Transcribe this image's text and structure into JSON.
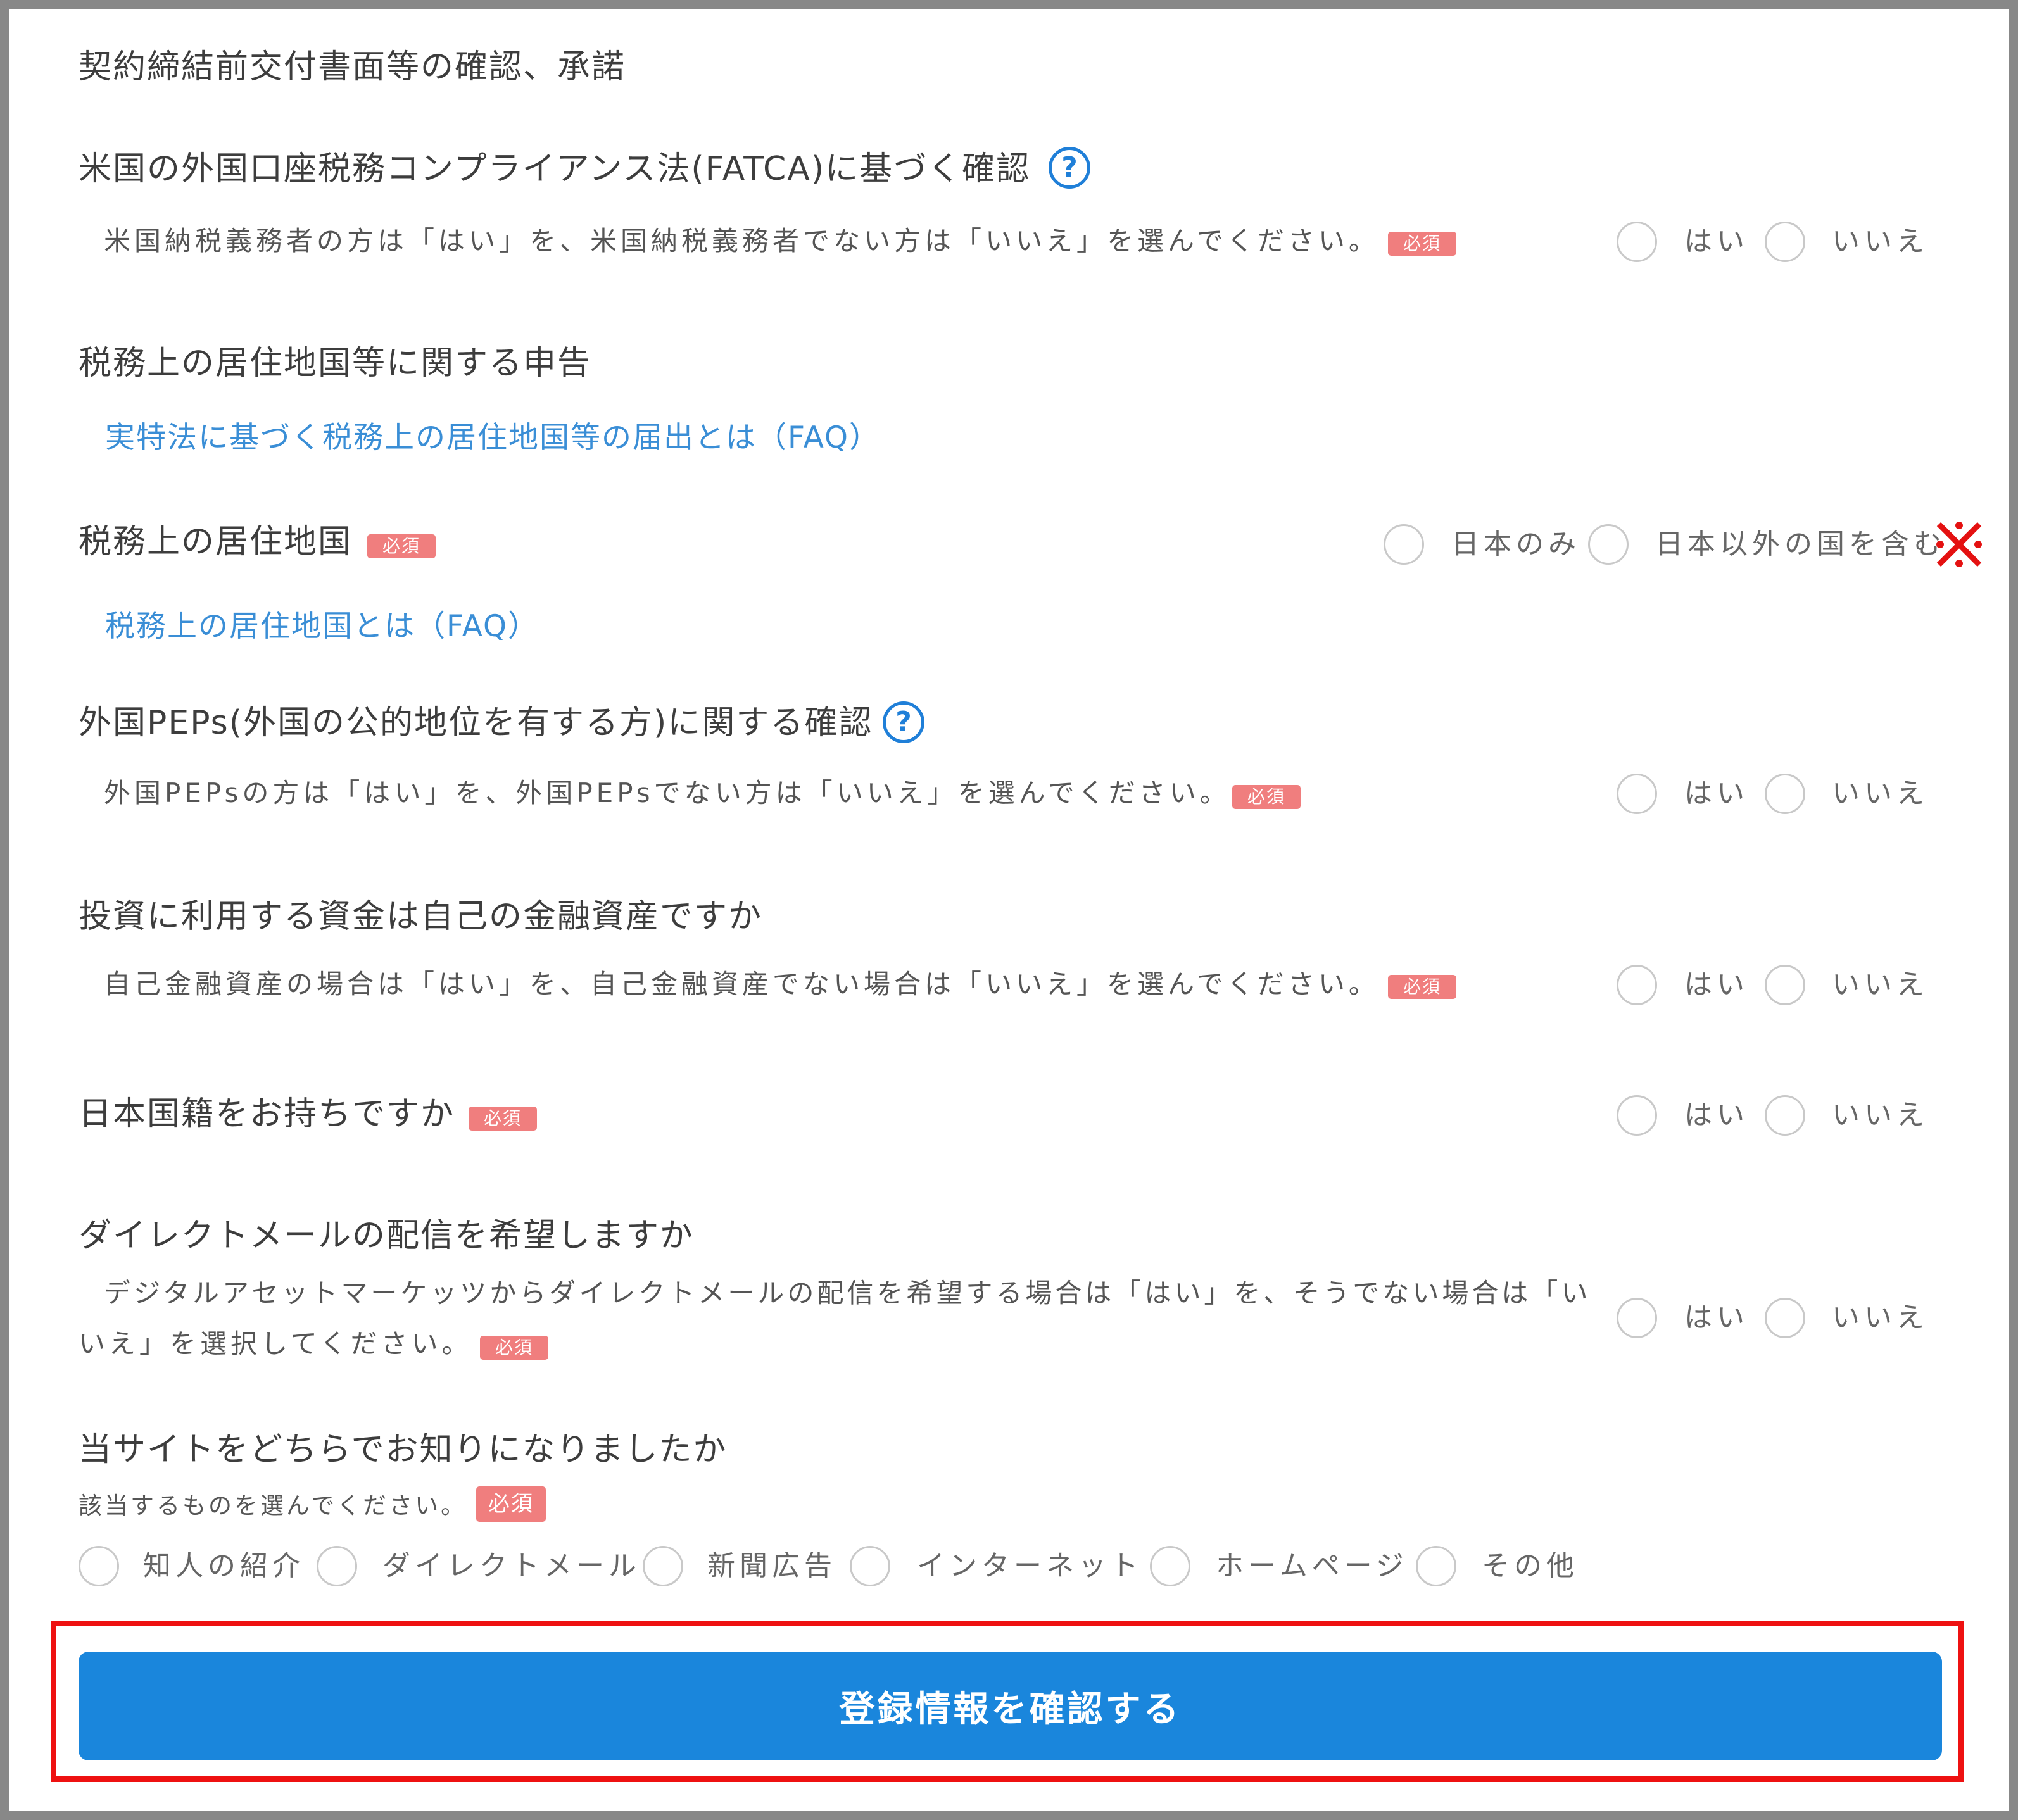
{
  "sections": {
    "consent_title": "契約締結前交付書面等の確認、承諾",
    "fatca": {
      "title": "米国の外国口座税務コンプライアンス法(FATCA)に基づく確認",
      "help_icon": "?",
      "description": "米国納税義務者の方は「はい」を、米国納税義務者でない方は「いいえ」を選んでください。",
      "badge": "必須",
      "options": [
        "はい",
        "いいえ"
      ]
    },
    "tax_declaration": {
      "title": "税務上の居住地国等に関する申告",
      "faq_link": "実特法に基づく税務上の居住地国等の届出とは（FAQ）"
    },
    "tax_residence": {
      "title": "税務上の居住地国",
      "badge": "必須",
      "options": [
        "日本のみ",
        "日本以外の国を含む"
      ],
      "annotation_mark": "※",
      "faq_link": "税務上の居住地国とは（FAQ）"
    },
    "peps": {
      "title": "外国PEPs(外国の公的地位を有する方)に関する確認",
      "help_icon": "?",
      "description": "外国PEPsの方は「はい」を、外国PEPsでない方は「いいえ」を選んでください。",
      "badge": "必須",
      "options": [
        "はい",
        "いいえ"
      ]
    },
    "own_funds": {
      "title": "投資に利用する資金は自己の金融資産ですか",
      "description": "自己金融資産の場合は「はい」を、自己金融資産でない場合は「いいえ」を選んでください。",
      "badge": "必須",
      "options": [
        "はい",
        "いいえ"
      ]
    },
    "nationality": {
      "title": "日本国籍をお持ちですか",
      "badge": "必須",
      "options": [
        "はい",
        "いいえ"
      ]
    },
    "direct_mail": {
      "title": "ダイレクトメールの配信を希望しますか",
      "description_line1": "デジタルアセットマーケッツからダイレクトメールの配信を希望する場合は「はい」を、そうでない場合は「い",
      "description_line2": "いえ」を選択してください。",
      "badge": "必須",
      "options": [
        "はい",
        "いいえ"
      ]
    },
    "referral": {
      "title": "当サイトをどちらでお知りになりましたか",
      "description": "該当するものを選んでください。",
      "badge": "必須",
      "options": [
        "知人の紹介",
        "ダイレクトメール",
        "新聞広告",
        "インターネット",
        "ホームページ",
        "その他"
      ]
    }
  },
  "submit_label": "登録情報を確認する",
  "colors": {
    "accent": "#1a86dc",
    "badge": "#f07e7e",
    "link": "#3a8ed6",
    "highlight": "#ee1111"
  },
  "icons": {
    "help": "question-circle-icon",
    "annotation": "reference-mark-icon"
  }
}
